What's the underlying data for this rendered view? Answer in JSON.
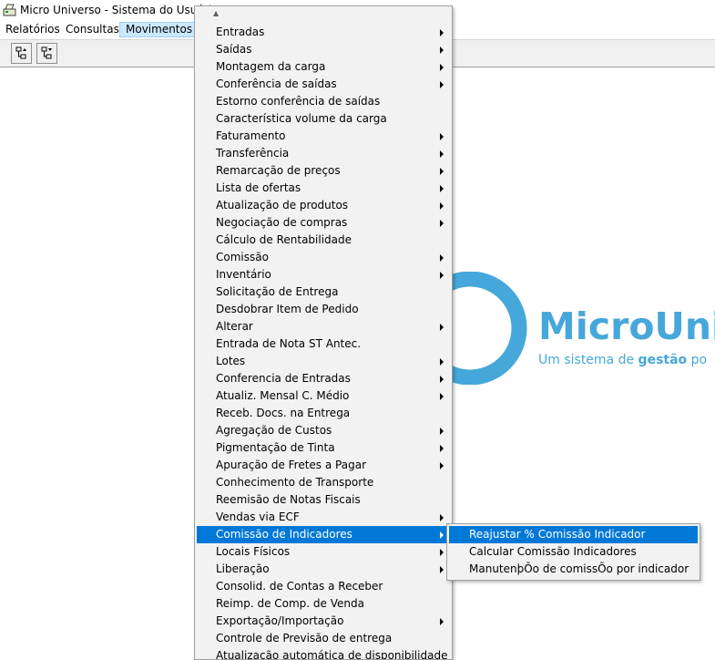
{
  "window": {
    "title": "Micro Universo - Sistema do Usuário"
  },
  "menubar": {
    "items": [
      "Relatórios",
      "Consultas",
      "Movimentos"
    ],
    "active": "Movimentos"
  },
  "toolbar": {
    "buttons": [
      "tree-up-icon",
      "tree-down-icon"
    ]
  },
  "logo": {
    "brand": "MicroUni",
    "tagline_pre": "Um sistema de ",
    "tagline_bold": "gestão",
    "tagline_post": " po",
    "color": "#46a7da"
  },
  "movimentos_menu": {
    "items": [
      {
        "label": "Entradas",
        "submenu": true
      },
      {
        "label": "Saídas",
        "submenu": true
      },
      {
        "label": "Montagem da carga",
        "submenu": true
      },
      {
        "label": "Conferência de saídas",
        "submenu": true
      },
      {
        "label": "Estorno conferência de saídas",
        "submenu": false
      },
      {
        "label": "Característica volume da carga",
        "submenu": false
      },
      {
        "label": "Faturamento",
        "submenu": true
      },
      {
        "label": "Transferência",
        "submenu": true
      },
      {
        "label": "Remarcação de preços",
        "submenu": true
      },
      {
        "label": "Lista de ofertas",
        "submenu": true
      },
      {
        "label": "Atualização de produtos",
        "submenu": true
      },
      {
        "label": "Negociação de compras",
        "submenu": true
      },
      {
        "label": "Cálculo de Rentabilidade",
        "submenu": false
      },
      {
        "label": "Comissão",
        "submenu": true
      },
      {
        "label": "Inventário",
        "submenu": true
      },
      {
        "label": "Solicitação de Entrega",
        "submenu": false
      },
      {
        "label": "Desdobrar Item de Pedido",
        "submenu": false
      },
      {
        "label": "Alterar",
        "submenu": true
      },
      {
        "label": "Entrada de Nota ST Antec.",
        "submenu": false
      },
      {
        "label": "Lotes",
        "submenu": true
      },
      {
        "label": "Conferencia de Entradas",
        "submenu": true
      },
      {
        "label": "Atualiz. Mensal C. Médio",
        "submenu": true
      },
      {
        "label": "Receb. Docs. na Entrega",
        "submenu": false
      },
      {
        "label": "Agregação de Custos",
        "submenu": true
      },
      {
        "label": "Pigmentação de Tinta",
        "submenu": true
      },
      {
        "label": "Apuração de Fretes a Pagar",
        "submenu": true
      },
      {
        "label": "Conhecimento de Transporte",
        "submenu": false
      },
      {
        "label": "Reemisão de Notas Fiscais",
        "submenu": false
      },
      {
        "label": "Vendas via ECF",
        "submenu": true
      },
      {
        "label": "Comissão de Indicadores",
        "submenu": true,
        "highlighted": true
      },
      {
        "label": "Locais Físicos",
        "submenu": true
      },
      {
        "label": "Liberação",
        "submenu": true
      },
      {
        "label": "Consolid. de Contas a Receber",
        "submenu": false
      },
      {
        "label": "Reimp. de Comp. de Venda",
        "submenu": false
      },
      {
        "label": "Exportação/Importação",
        "submenu": true
      },
      {
        "label": "Controle de Previsão de entrega",
        "submenu": false
      },
      {
        "label": "Atualização automática de disponibilidade",
        "submenu": false
      }
    ]
  },
  "comissao_submenu": {
    "items": [
      {
        "label": "Reajustar % Comissão Indicador",
        "highlighted": true
      },
      {
        "label": "Calcular Comissão Indicadores",
        "highlighted": false
      },
      {
        "label": "ManutenþÕo de comissÕo por indicador",
        "highlighted": false
      }
    ]
  },
  "colors": {
    "highlight": "#0078d7",
    "menu_bg": "#f2f2f2",
    "menubar_active": "#cce8ff"
  }
}
